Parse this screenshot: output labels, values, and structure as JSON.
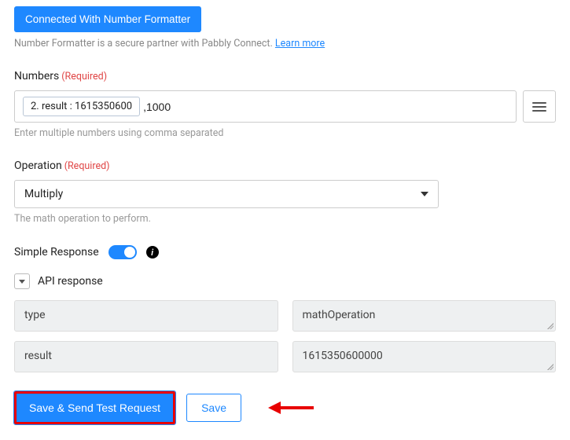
{
  "header": {
    "connected_label": "Connected With Number Formatter",
    "secure_text": "Number Formatter is a secure partner with Pabbly Connect. ",
    "learn_more": "Learn more"
  },
  "numbers": {
    "label": "Numbers",
    "required": "(Required)",
    "tag": "2. result : 1615350600",
    "value": ",1000",
    "hint": "Enter multiple numbers using comma separated"
  },
  "operation": {
    "label": "Operation",
    "required": "(Required)",
    "value": "Multiply",
    "hint": "The math operation to perform."
  },
  "simple_response": {
    "label": "Simple Response"
  },
  "api": {
    "label": "API response",
    "rows": [
      {
        "key": "type",
        "value": "mathOperation"
      },
      {
        "key": "result",
        "value": "1615350600000"
      }
    ]
  },
  "footer": {
    "primary": "Save & Send Test Request",
    "secondary": "Save"
  }
}
